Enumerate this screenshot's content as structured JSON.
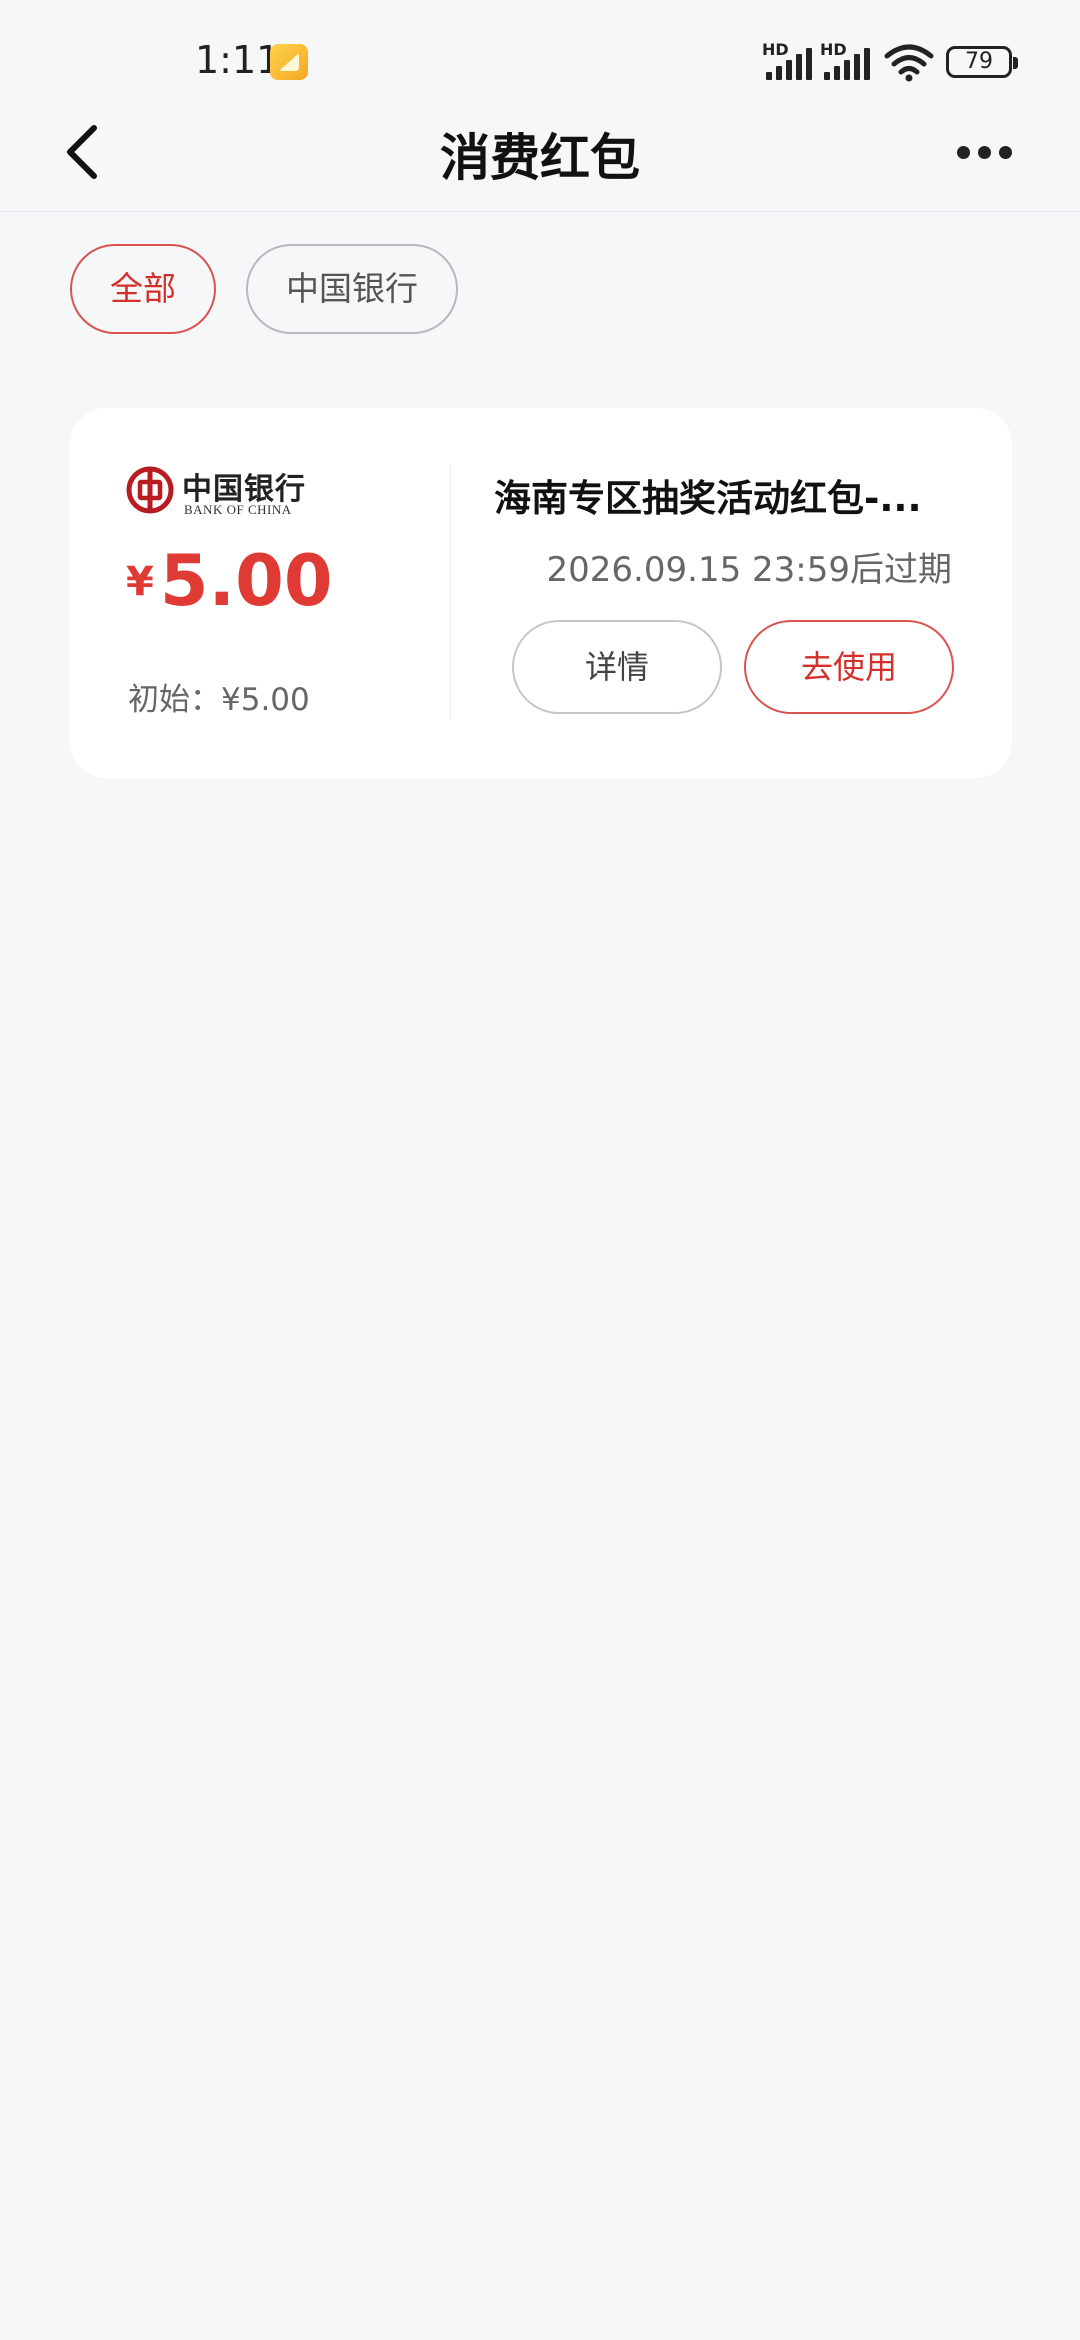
{
  "status_bar": {
    "time": "1:11",
    "sim1_label": "HD",
    "sim2_label": "HD",
    "battery": "79"
  },
  "header": {
    "title": "消费红包",
    "back_icon": "chevron-left-icon",
    "more_icon": "more-horizontal-icon"
  },
  "filters": [
    {
      "label": "全部",
      "active": true
    },
    {
      "label": "中国银行",
      "active": false
    }
  ],
  "coupon": {
    "bank_name_cn": "中国银行",
    "bank_name_en": "BANK OF CHINA",
    "currency_symbol": "¥",
    "amount": "5.00",
    "initial": "初始：¥5.00",
    "title": "海南专区抽奖活动红包-...",
    "expiry": "2026.09.15 23:59后过期",
    "detail_button": "详情",
    "use_button": "去使用"
  },
  "colors": {
    "accent": "#e03a34",
    "background": "#f6f7f9",
    "card": "#ffffff"
  }
}
